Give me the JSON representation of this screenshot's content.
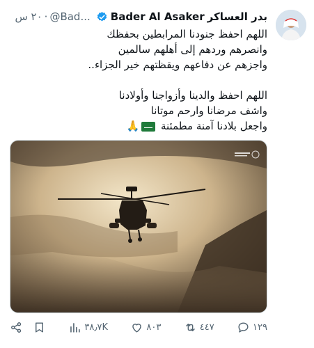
{
  "author": {
    "name_arabic": "بدر العساكر",
    "name_latin": "Bader Al Asaker",
    "handle": "@Bad...",
    "time": "٢٠ س"
  },
  "tweet": {
    "lines_block1": [
      "اللهم احفظ جنودنا المرابطين بحفظك",
      "وانصرهم وردهم إلى أهلهم سالمين",
      "واجزهم عن دفاعهم ويقظتهم خير الجزاء.."
    ],
    "lines_block2": [
      "اللهم احفظ والدينا وأزواجنا وأولادنا",
      "واشف مرضانا وارحم موتانا",
      "واجعل بلادنا آمنة مطمئنة"
    ],
    "emoji_tail": "🙏"
  },
  "actions": {
    "replies": "١٢٩",
    "reposts": "٤٤٧",
    "likes": "٨٠٣",
    "views": "٣٨٫٧K"
  },
  "colors": {
    "verified": "#1d9bf0",
    "muted": "#536471",
    "flag": "#1f7a3a"
  }
}
